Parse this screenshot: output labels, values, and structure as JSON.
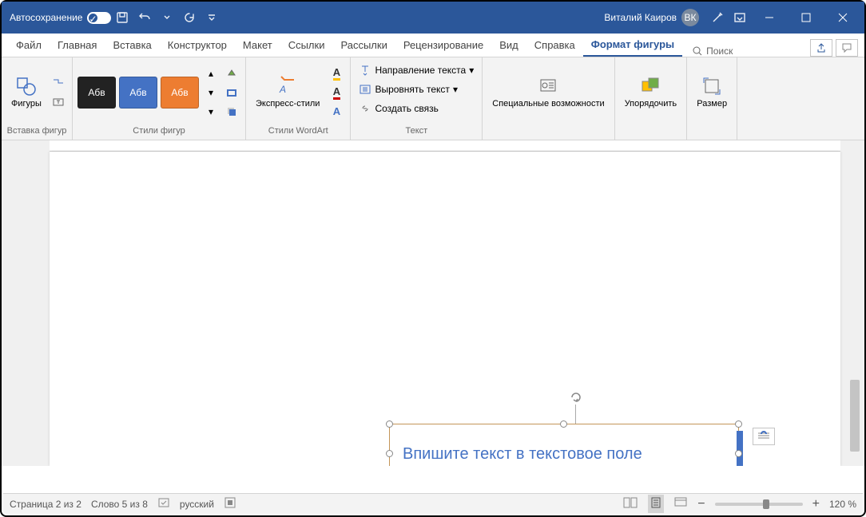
{
  "titlebar": {
    "autosave": "Автосохранение",
    "user_name": "Виталий Каиров",
    "user_initials": "ВК"
  },
  "tabs": {
    "file": "Файл",
    "home": "Главная",
    "insert": "Вставка",
    "design": "Конструктор",
    "layout": "Макет",
    "references": "Ссылки",
    "mailings": "Рассылки",
    "review": "Рецензирование",
    "view": "Вид",
    "help": "Справка",
    "shape_format": "Формат фигуры",
    "search": "Поиск"
  },
  "ribbon": {
    "shapes": "Фигуры",
    "insert_shapes": "Вставка фигур",
    "swatch_label": "Абв",
    "shape_styles": "Стили фигур",
    "wordart": "Экспресс-стили",
    "wordart_styles": "Стили WordArt",
    "text_direction": "Направление текста",
    "align_text": "Выровнять текст",
    "create_link": "Создать связь",
    "text_group": "Текст",
    "accessibility": "Специальные возможности",
    "arrange": "Упорядочить",
    "size": "Размер"
  },
  "textbox": {
    "content": "Впишите текст в текстовое поле"
  },
  "statusbar": {
    "page": "Страница 2 из 2",
    "words": "Слово 5 из 8",
    "language": "русский",
    "zoom": "120 %"
  }
}
